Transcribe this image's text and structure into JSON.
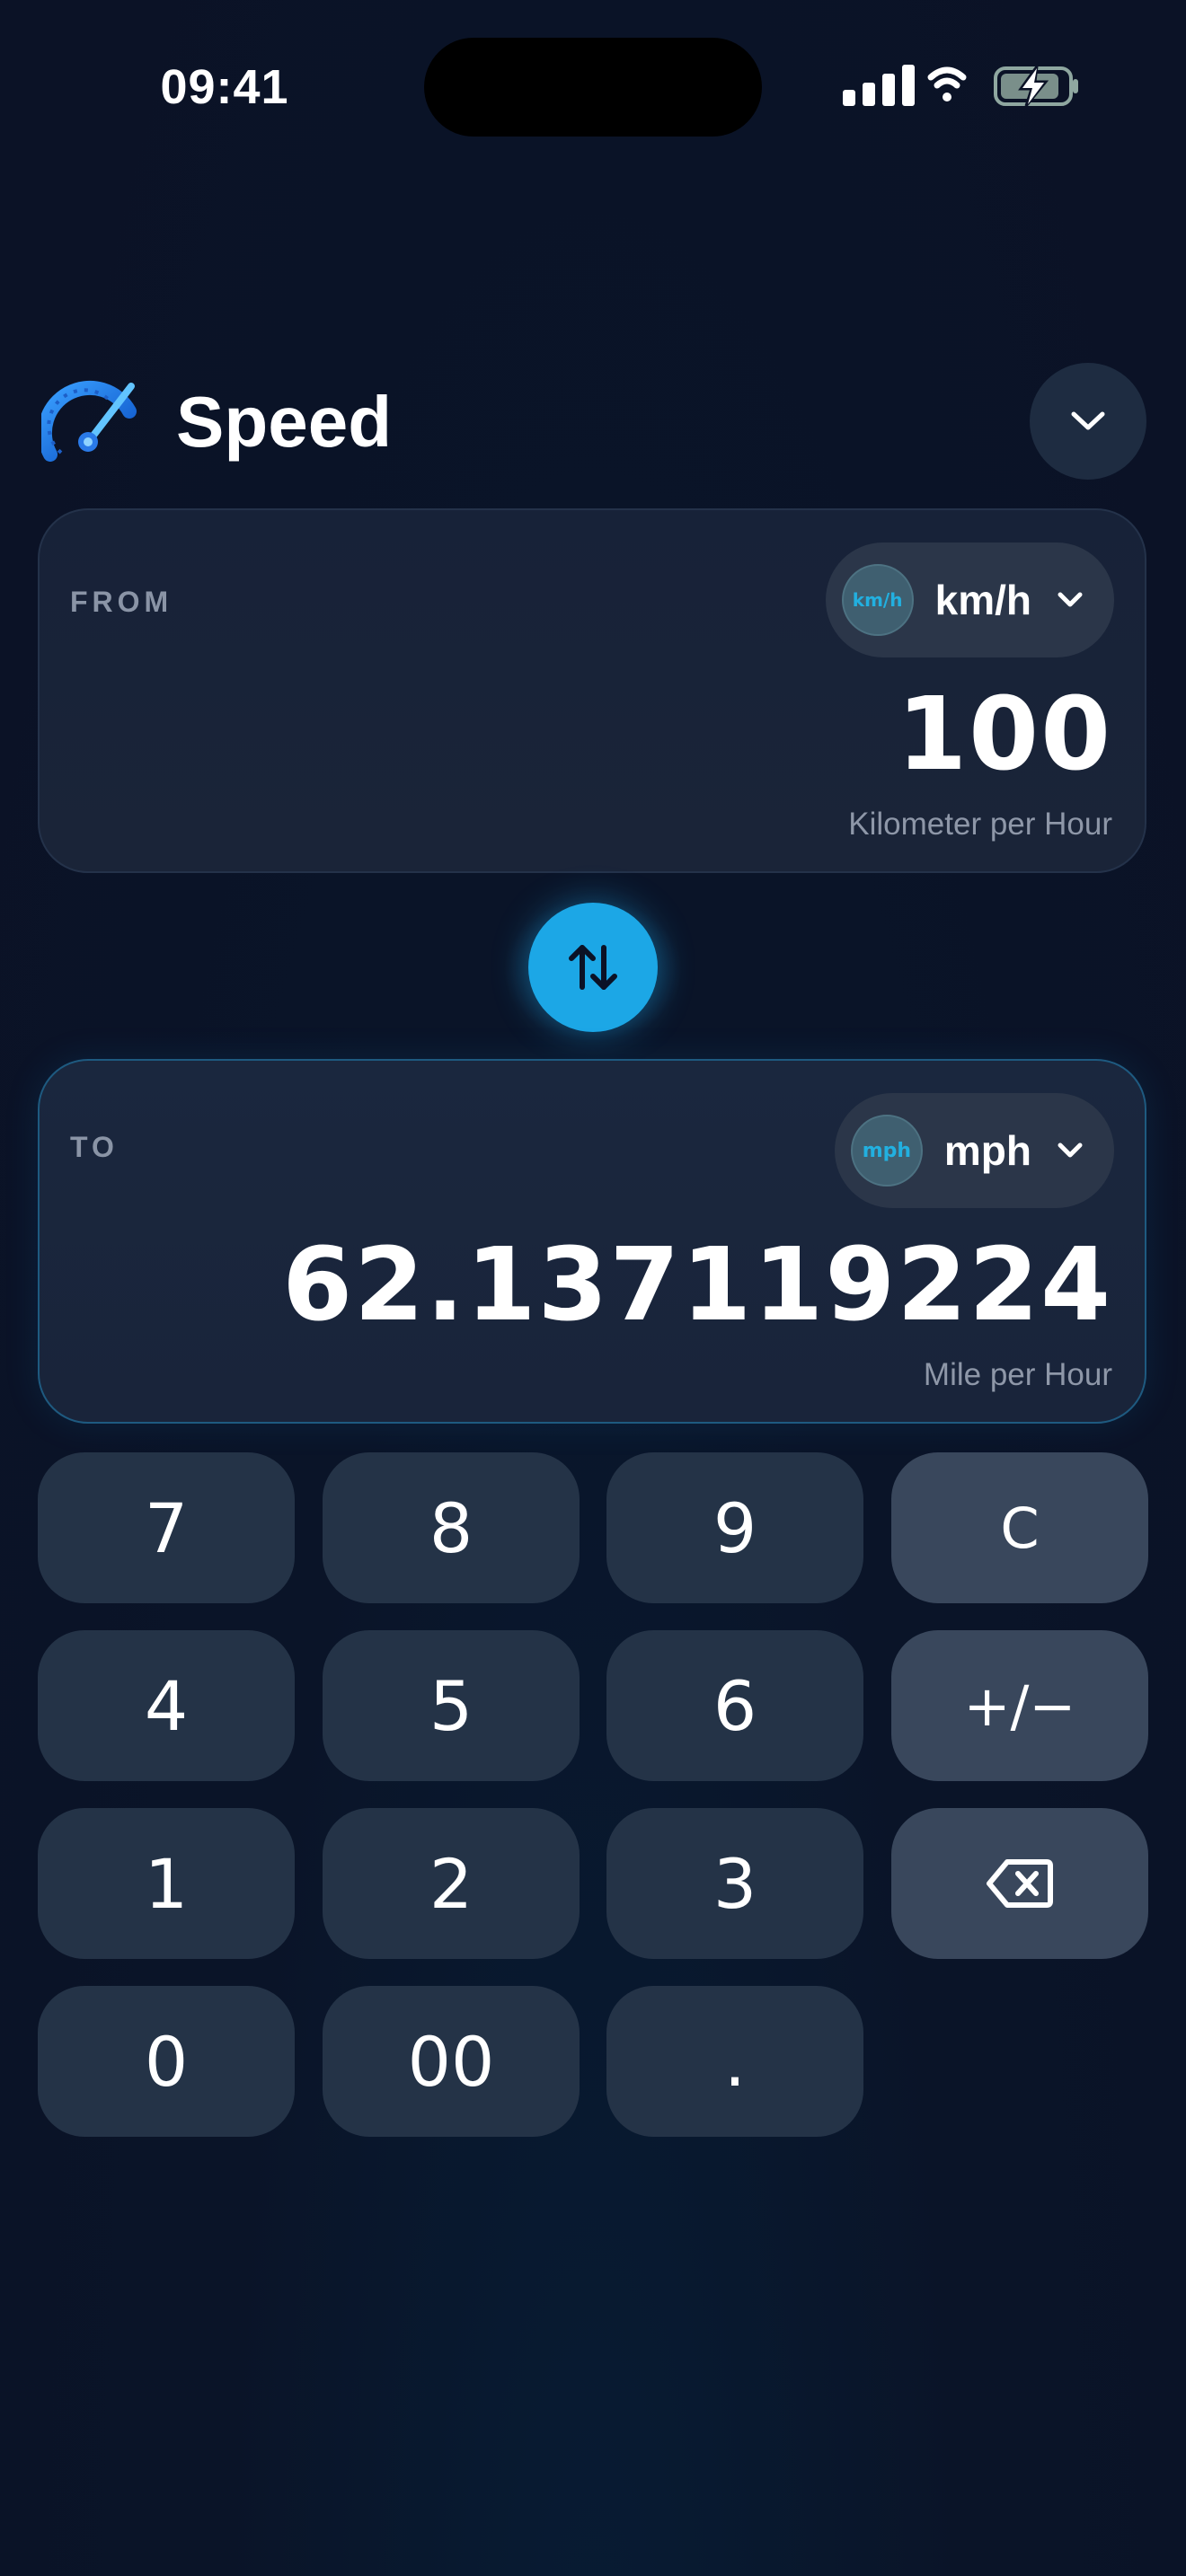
{
  "status_bar": {
    "time": "09:41",
    "icons": [
      "signal-icon",
      "wifi-icon",
      "battery-charging-icon"
    ]
  },
  "header": {
    "icon": "speedometer-icon",
    "title": "Speed",
    "toggle_icon": "chevron-down-icon"
  },
  "from_card": {
    "label": "FROM",
    "unit_badge": "km/h",
    "unit": "km/h",
    "value": "100",
    "unit_full": "Kilometer per Hour"
  },
  "swap": {
    "icon": "swap-vertical-icon"
  },
  "to_card": {
    "label": "TO",
    "unit_badge": "mph",
    "unit": "mph",
    "value": "62.137119224",
    "unit_full": "Mile per Hour"
  },
  "keypad": {
    "k7": "7",
    "k8": "8",
    "k9": "9",
    "clear": "C",
    "k4": "4",
    "k5": "5",
    "k6": "6",
    "sign": "+/−",
    "k1": "1",
    "k2": "2",
    "k3": "3",
    "backspace_icon": "backspace-icon",
    "k0": "0",
    "k00": "00",
    "decimal": "."
  },
  "colors": {
    "accent": "#1ca7e6",
    "background": "#0b1226",
    "card": "#172238",
    "key": "#243347",
    "key_function": "#39475c"
  }
}
